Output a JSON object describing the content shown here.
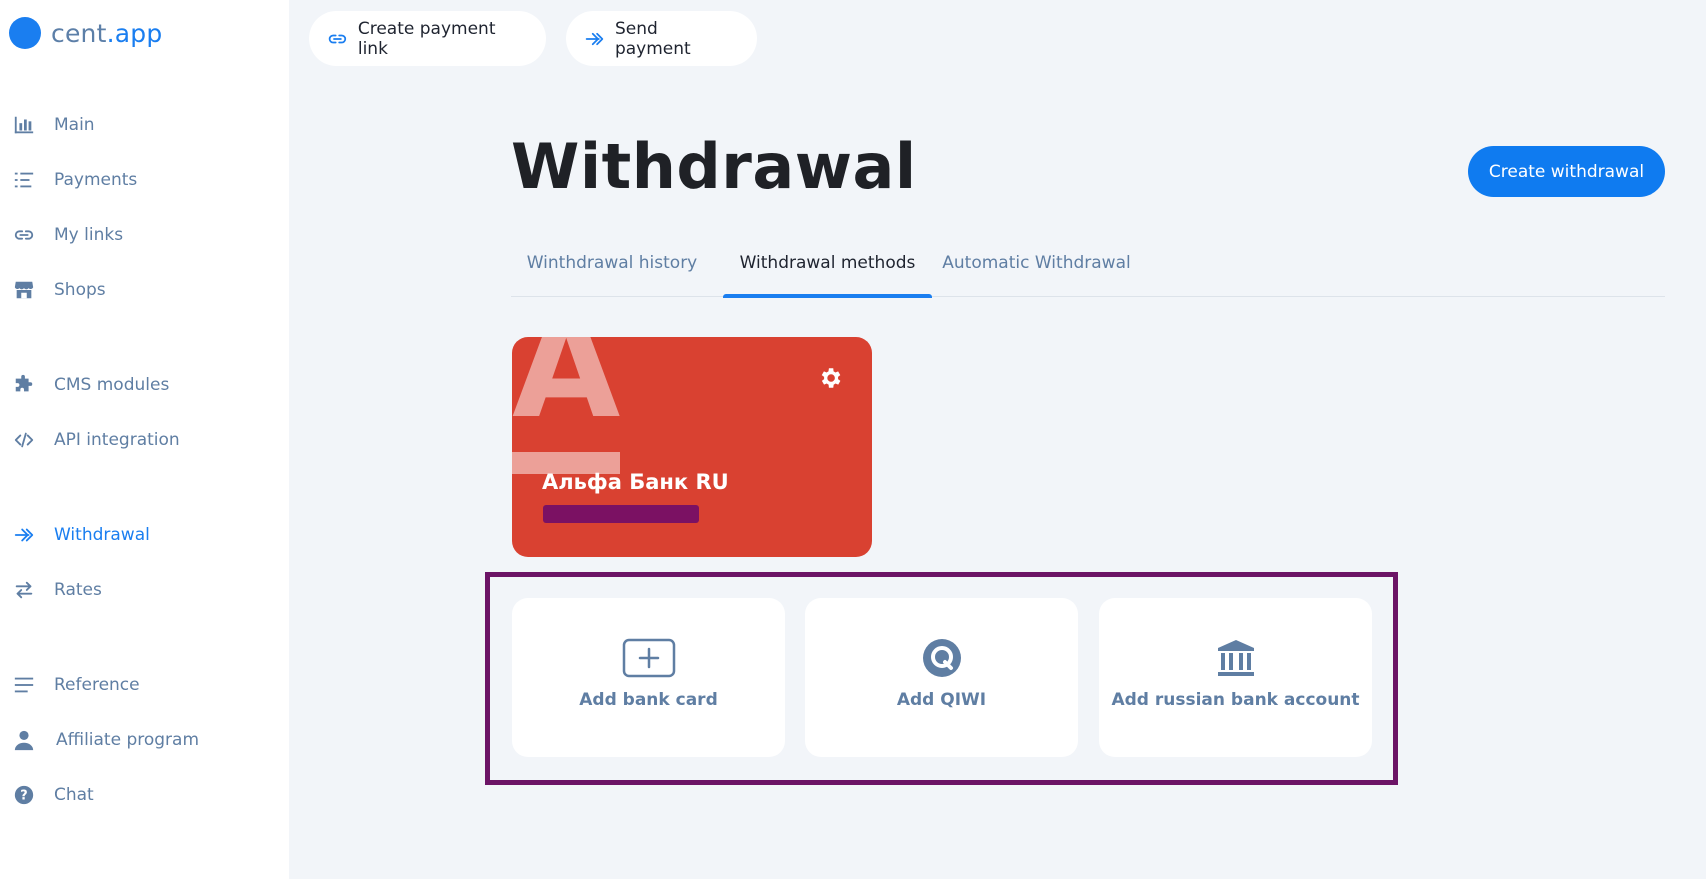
{
  "logo": {
    "part1": "cent",
    "part2": ".app"
  },
  "sidebar": {
    "items": [
      {
        "label": "Main",
        "icon": "bar-chart-icon"
      },
      {
        "label": "Payments",
        "icon": "list-icon"
      },
      {
        "label": "My links",
        "icon": "link-icon"
      },
      {
        "label": "Shops",
        "icon": "store-icon"
      },
      {
        "label": "CMS modules",
        "icon": "puzzle-icon"
      },
      {
        "label": "API integration",
        "icon": "code-icon"
      },
      {
        "label": "Withdrawal",
        "icon": "double-arrow-icon",
        "active": true
      },
      {
        "label": "Rates",
        "icon": "swap-icon"
      },
      {
        "label": "Reference",
        "icon": "menu-lines-icon"
      },
      {
        "label": "Affiliate program",
        "icon": "user-icon"
      },
      {
        "label": "Chat",
        "icon": "help-circle-icon"
      }
    ]
  },
  "topbar": {
    "create_link_label": "Create payment link",
    "send_payment_label": "Send payment"
  },
  "main": {
    "title": "Withdrawal",
    "create_button": "Create withdrawal",
    "tabs": [
      {
        "label": "Winthdrawal history"
      },
      {
        "label": "Withdrawal methods",
        "active": true
      },
      {
        "label": "Automatic Withdrawal"
      }
    ],
    "bank_card": {
      "name": "Альфа Банк RU",
      "logo_letter": "A"
    },
    "methods": [
      {
        "label": "Add bank card",
        "icon": "add-card-icon"
      },
      {
        "label": "Add QIWI",
        "icon": "qiwi-icon"
      },
      {
        "label": "Add russian bank account",
        "icon": "bank-building-icon"
      }
    ]
  },
  "colors": {
    "accent": "#1a7ef0",
    "sidebar_text": "#5f7ea3",
    "bank_card": "#d94131",
    "highlight": "#6c1466",
    "background": "#f2f5f9"
  }
}
